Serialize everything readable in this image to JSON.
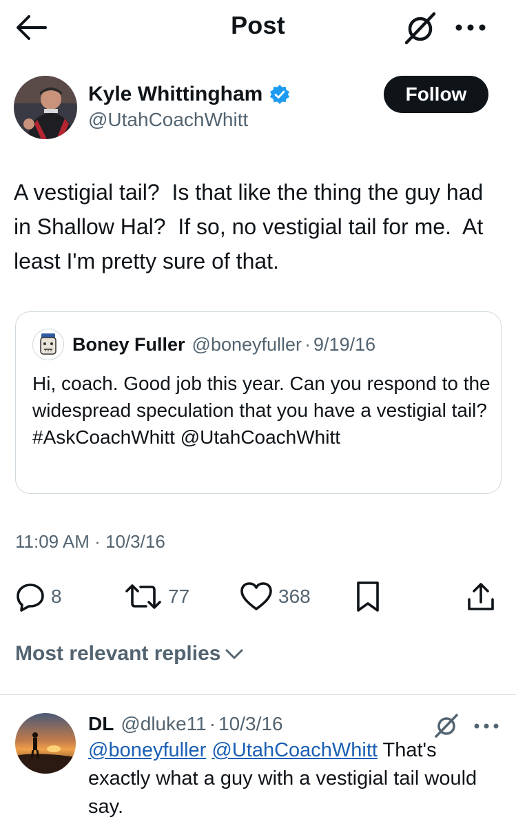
{
  "header": {
    "title": "Post",
    "icons": {
      "back": "back-arrow-icon",
      "grok": "grok-icon",
      "more": "more-icon"
    }
  },
  "tweet": {
    "author_name": "Kyle Whittingham",
    "author_handle": "@UtahCoachWhitt",
    "verified": true,
    "follow_label": "Follow",
    "text": "A vestigial tail?  Is that like the thing the guy had in Shallow Hal?  If so, no vestigial tail for me.  At least I'm pretty sure of that.",
    "timestamp": "11:09 AM · 10/3/16",
    "stats": {
      "replies": "8",
      "reposts": "77",
      "likes": "368"
    }
  },
  "quote": {
    "author_name": "Boney Fuller",
    "author_handle": "@boneyfuller",
    "separator": "·",
    "date": "9/19/16",
    "text": "Hi, coach. Good job this year. Can you respond to the widespread speculation that you have a vestigial tail? #AskCoachWhitt @UtahCoachWhitt"
  },
  "replies_sort": {
    "label": "Most relevant replies"
  },
  "replies": [
    {
      "author_name": "DL",
      "author_handle": "@dluke11",
      "separator": "·",
      "date": "10/3/16",
      "mention_1": "@boneyfuller",
      "mention_2": "@UtahCoachWhitt",
      "text": "That's exactly what a guy with a vestigial tail would say."
    }
  ],
  "colors": {
    "text": "#0f1419",
    "muted": "#536471",
    "accent": "#1d9bf0",
    "border": "#cfd9de",
    "follow_bg": "#0f1419"
  }
}
